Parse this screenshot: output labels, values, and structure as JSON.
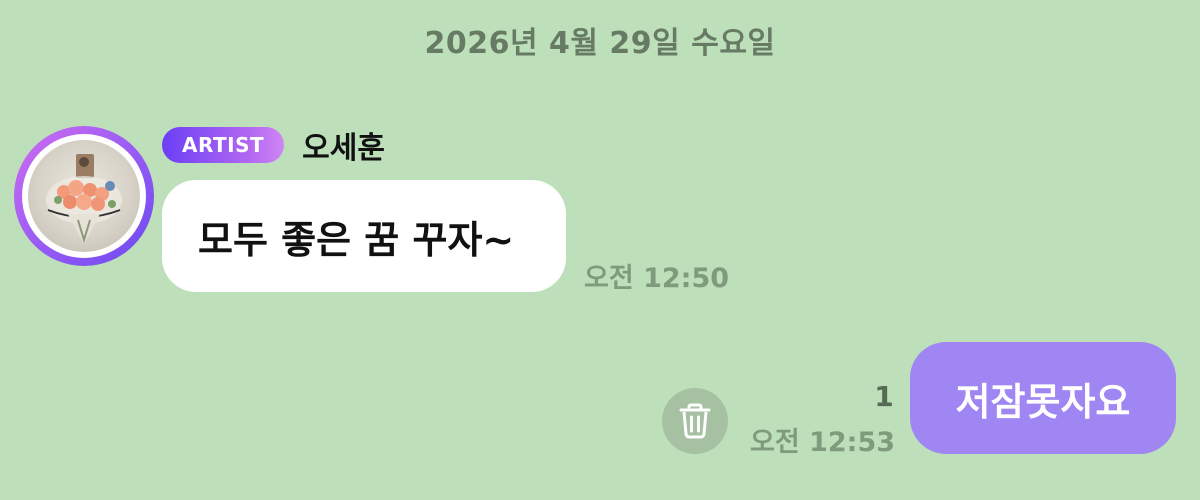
{
  "date_separator": "2026년 4월 29일 수요일",
  "incoming_message": {
    "badge": "ARTIST",
    "sender_name": "오세훈",
    "text": "모두 좋은 꿈 꾸자~",
    "time": "오전 12:50",
    "avatar_icon": "profile-photo-flower-bouquet"
  },
  "outgoing_message": {
    "text": "저잠못자요",
    "unread_count": "1",
    "time": "오전 12:53",
    "delete_icon": "trash-icon"
  },
  "colors": {
    "background": "#bde0ba",
    "outgoing_bubble": "#9f86f2",
    "incoming_bubble": "#ffffff",
    "badge_gradient_start": "#6b3ff5",
    "badge_gradient_end": "#cf86f4",
    "timestamp": "#7f9a7c"
  }
}
